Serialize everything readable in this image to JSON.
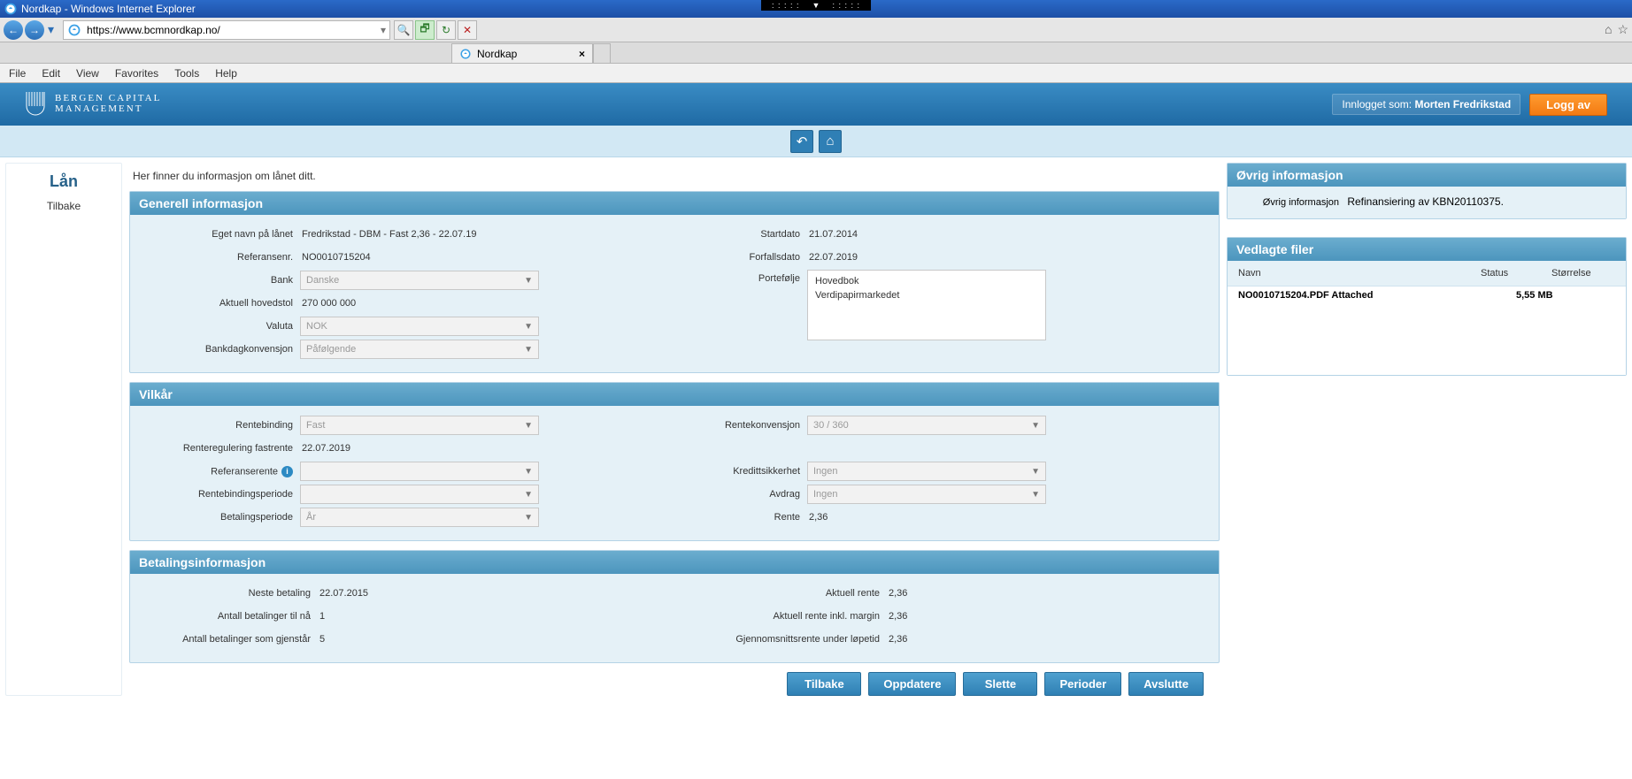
{
  "window": {
    "title": "Nordkap - Windows Internet Explorer"
  },
  "addr": {
    "url": "https://www.bcmnordkap.no/"
  },
  "tab": {
    "title": "Nordkap"
  },
  "menu": {
    "file": "File",
    "edit": "Edit",
    "view": "View",
    "favorites": "Favorites",
    "tools": "Tools",
    "help": "Help"
  },
  "header": {
    "brand_line1": "BERGEN CAPITAL",
    "brand_line2": "MANAGEMENT",
    "logged_in_prefix": "Innlogget som: ",
    "logged_in_user": "Morten Fredrikstad",
    "logout": "Logg av"
  },
  "leftnav": {
    "title": "Lån",
    "back": "Tilbake"
  },
  "intro": "Her finner du informasjon om lånet ditt.",
  "sections": {
    "general": "Generell informasjon",
    "terms": "Vilkår",
    "payment": "Betalingsinformasjon",
    "other": "Øvrig informasjon",
    "files": "Vedlagte filer"
  },
  "general": {
    "labels": {
      "eget_navn": "Eget navn på lånet",
      "referansenr": "Referansenr.",
      "bank": "Bank",
      "aktuell_hovedstol": "Aktuell hovedstol",
      "valuta": "Valuta",
      "bankdagkonvensjon": "Bankdagkonvensjon",
      "startdato": "Startdato",
      "forfallsdato": "Forfallsdato",
      "portefolje": "Portefølje"
    },
    "values": {
      "eget_navn": "Fredrikstad - DBM - Fast 2,36 - 22.07.19",
      "referansenr": "NO0010715204",
      "bank": "Danske",
      "aktuell_hovedstol": "270 000 000",
      "valuta": "NOK",
      "bankdagkonvensjon": "Påfølgende",
      "startdato": "21.07.2014",
      "forfallsdato": "22.07.2019",
      "portefolje": [
        "Hovedbok",
        "Verdipapirmarkedet"
      ]
    }
  },
  "terms": {
    "labels": {
      "rentebinding": "Rentebinding",
      "renteregulering_fastrente": "Renteregulering fastrente",
      "referanserente": "Referanserente",
      "rentebindingsperiode": "Rentebindingsperiode",
      "betalingsperiode": "Betalingsperiode",
      "rentekonvensjon": "Rentekonvensjon",
      "kredittsikkerhet": "Kredittsikkerhet",
      "avdrag": "Avdrag",
      "rente": "Rente"
    },
    "values": {
      "rentebinding": "Fast",
      "renteregulering_fastrente": "22.07.2019",
      "referanserente": "",
      "rentebindingsperiode": "",
      "betalingsperiode": "År",
      "rentekonvensjon": "30 / 360",
      "kredittsikkerhet": "Ingen",
      "avdrag": "Ingen",
      "rente": "2,36"
    }
  },
  "payment": {
    "labels": {
      "neste_betaling": "Neste betaling",
      "antall_til_na": "Antall betalinger til nå",
      "antall_gjenstar": "Antall betalinger som gjenstår",
      "aktuell_rente": "Aktuell rente",
      "aktuell_rente_margin": "Aktuell rente inkl. margin",
      "gjsnitt_rente": "Gjennomsnittsrente under løpetid"
    },
    "values": {
      "neste_betaling": "22.07.2015",
      "antall_til_na": "1",
      "antall_gjenstar": "5",
      "aktuell_rente": "2,36",
      "aktuell_rente_margin": "2,36",
      "gjsnitt_rente": "2,36"
    }
  },
  "other_info": {
    "label": "Øvrig informasjon",
    "value": "Refinansiering av KBN20110375."
  },
  "files": {
    "headers": {
      "name": "Navn",
      "status": "Status",
      "size": "Størrelse"
    },
    "rows": [
      {
        "name": "NO0010715204.PDF",
        "status": "Attached",
        "size": "5,55 MB"
      }
    ]
  },
  "actions": {
    "tilbake": "Tilbake",
    "oppdatere": "Oppdatere",
    "slette": "Slette",
    "perioder": "Perioder",
    "avslutte": "Avslutte"
  }
}
